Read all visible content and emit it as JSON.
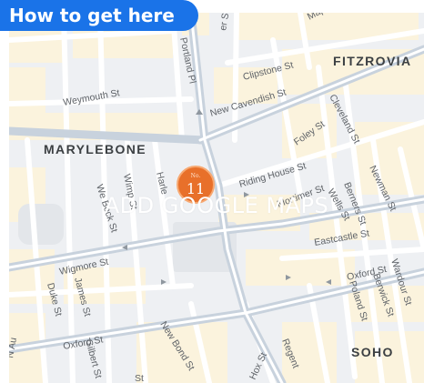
{
  "heading": "How to get here",
  "map": {
    "placeholder": "ADD GOOGLE MAPS",
    "marker": {
      "prefix": "No.",
      "number": "11"
    },
    "districts": [
      "FITZROVIA",
      "MARYLEBONE",
      "SOHO"
    ],
    "streets": {
      "er_st": "er St",
      "maple_st": "Maple",
      "portland_pl": "Portland Pl",
      "clipstone_st": "Clipstone St",
      "weymouth_st": "Weymouth St",
      "new_cavendish_st": "New Cavendish St",
      "cleveland_st": "Cleveland St",
      "foley_st": "Foley St",
      "riding_house_st": "Riding House St",
      "mortimer_st": "Mortimer St",
      "wells_st": "Wells St",
      "newman_st": "Newman St",
      "berners_st": "Berners St",
      "we_beck_st": "We Beck St",
      "wimpole_st": "Wimp St",
      "harley_st": "Harle",
      "eastcastle_st": "Eastcastle St",
      "wigmore_st": "Wigmore St",
      "oxford_st_east": "Oxford St",
      "oxford_st_west": "Oxford St",
      "duke_st": "Duke St",
      "james_st": "James St",
      "gilbert_st": "Gilbert St",
      "new_bond_st": "New Bond St",
      "poland_st": "Poland St",
      "berwick_st": "Berwick St",
      "wardour_st": "Wardour St",
      "regent": "Regent",
      "hox_st": "Hox St",
      "n_au": "N Au",
      "st_bottom": "St"
    }
  }
}
